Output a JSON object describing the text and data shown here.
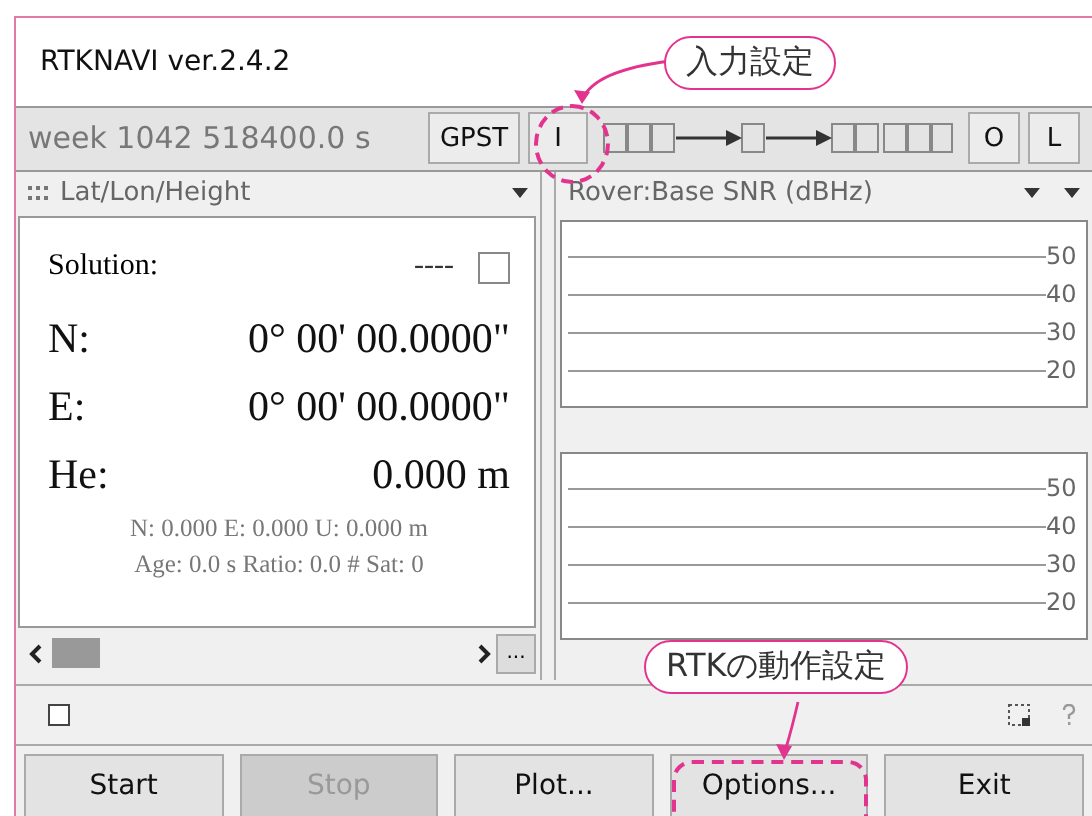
{
  "window": {
    "title": "RTKNAVI ver.2.4.2"
  },
  "toolbar": {
    "time": "week 1042 518400.0 s",
    "time_system_button": "GPST",
    "input_button": "I",
    "output_button": "O",
    "log_button": "L"
  },
  "solution_panel": {
    "view": "Lat/Lon/Height",
    "solution_label": "Solution:",
    "solution_status": "----",
    "solution_checked": false,
    "rows": [
      {
        "label": "N:",
        "value": "0° 00' 00.0000\""
      },
      {
        "label": "E:",
        "value": "0° 00' 00.0000\""
      },
      {
        "label": "He:",
        "value": "0.000 m"
      }
    ],
    "info_lines": [
      "N: 0.000 E: 0.000 U: 0.000 m",
      "Age: 0.0 s Ratio: 0.0 # Sat: 0"
    ],
    "more_button": "..."
  },
  "snr_panel": {
    "view": "Rover:Base SNR (dBHz)",
    "charts": [
      {
        "ticks": [
          "50",
          "40",
          "30",
          "20"
        ]
      },
      {
        "ticks": [
          "50",
          "40",
          "30",
          "20"
        ]
      }
    ]
  },
  "buttons": [
    {
      "label": "Start",
      "disabled": false
    },
    {
      "label": "Stop",
      "disabled": true
    },
    {
      "label": "Plot...",
      "disabled": false
    },
    {
      "label": "Options...",
      "disabled": false
    },
    {
      "label": "Exit",
      "disabled": false
    }
  ],
  "callouts": [
    {
      "text": "入力設定"
    },
    {
      "text": "RTKの動作設定"
    }
  ]
}
